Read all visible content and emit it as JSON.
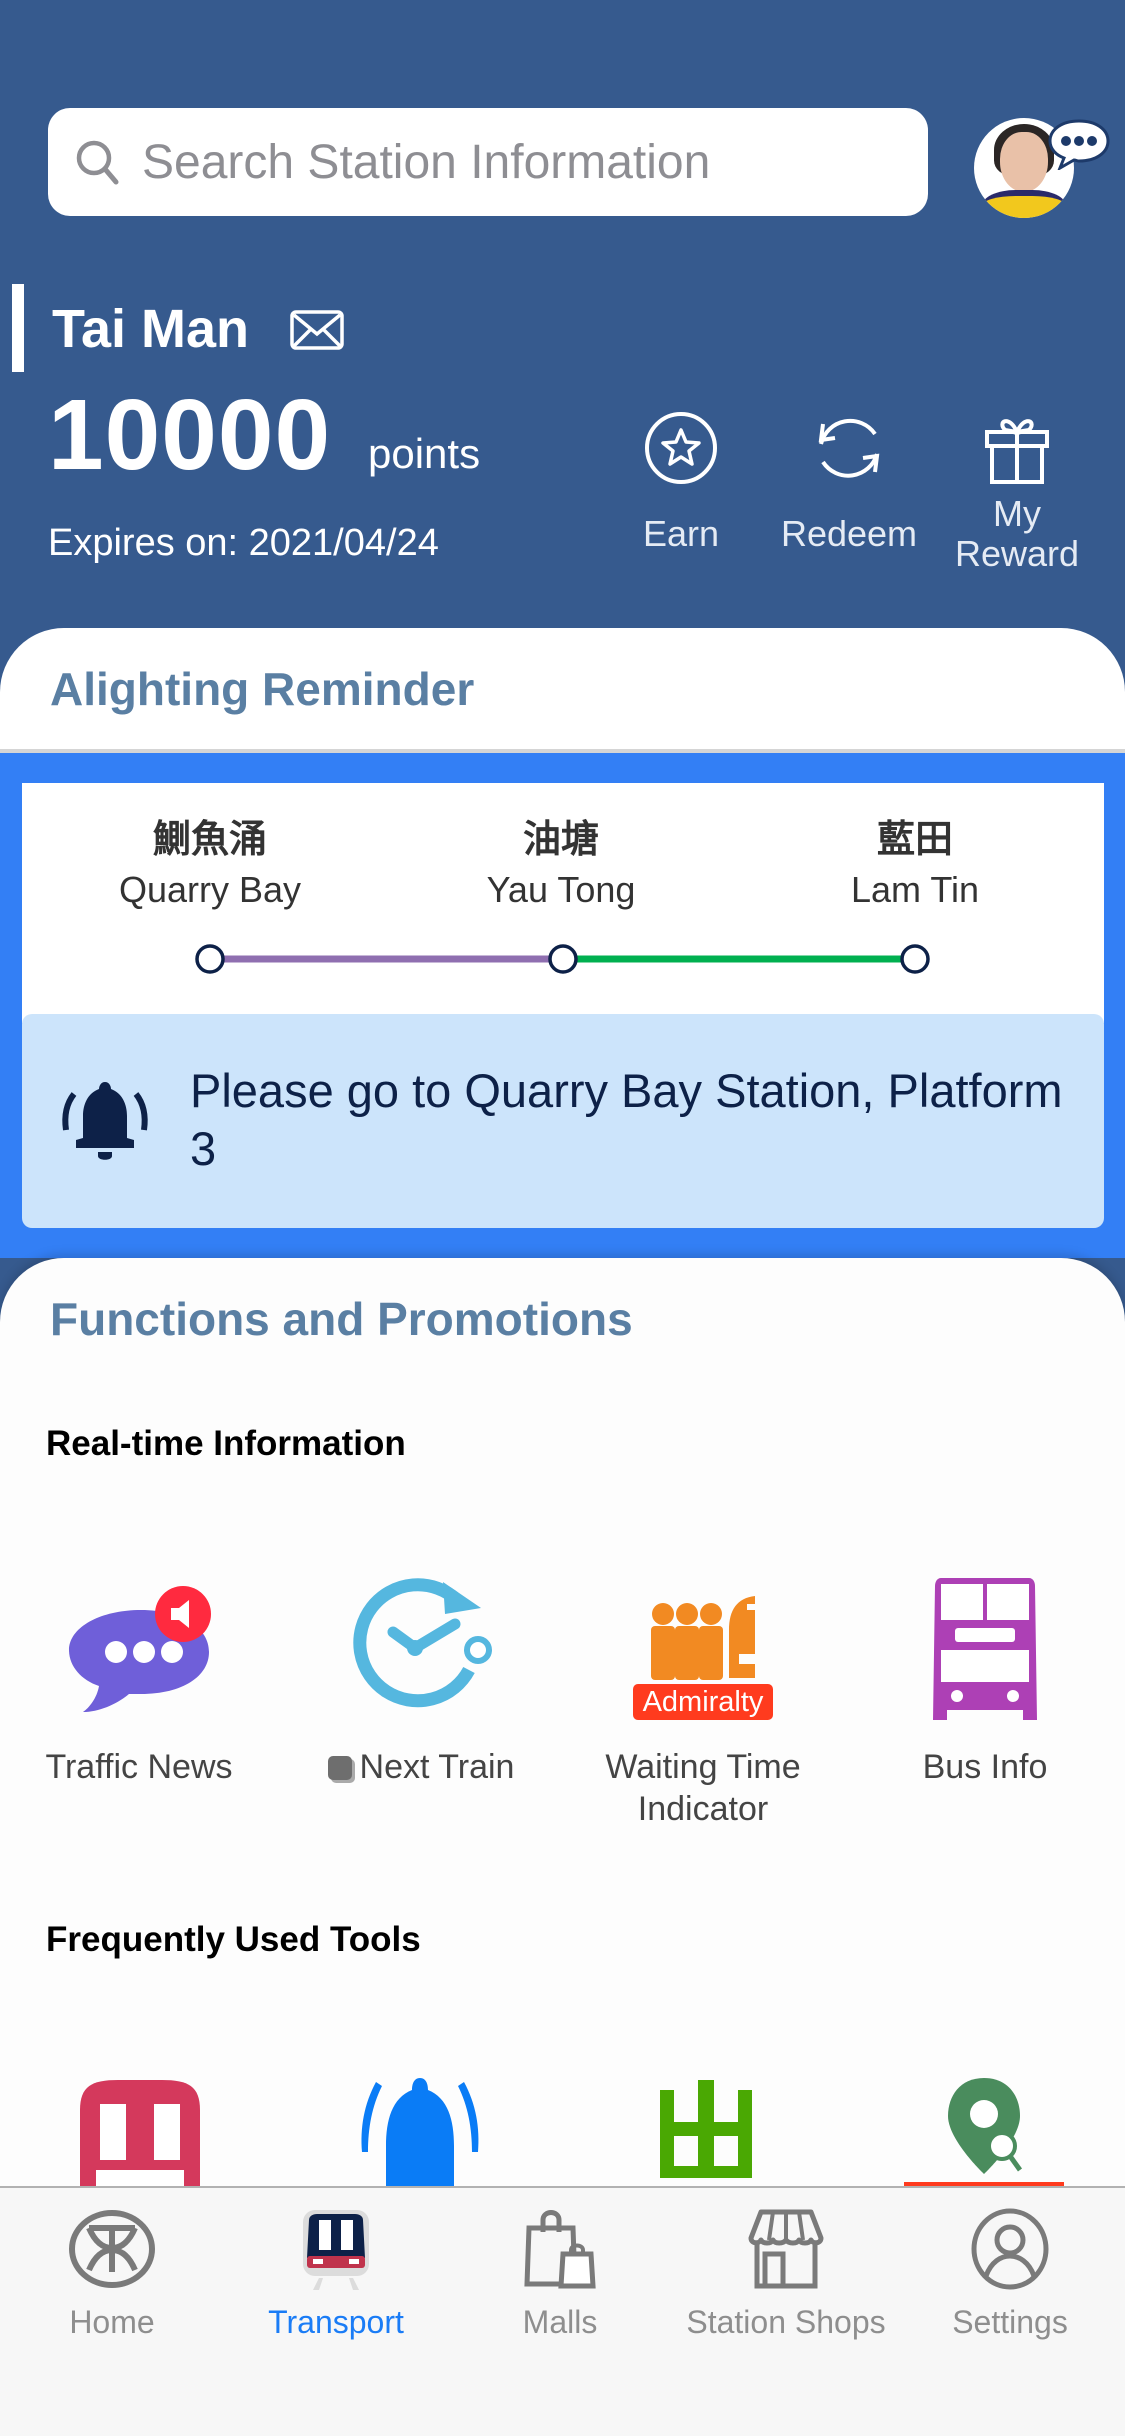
{
  "search": {
    "placeholder": "Search Station Information"
  },
  "user": {
    "name": "Tai Man",
    "points": "10000",
    "points_unit": "points",
    "expires": "Expires on: 2021/04/24"
  },
  "actions": [
    {
      "label": "Earn",
      "icon": "star-circle-icon"
    },
    {
      "label": "Redeem",
      "icon": "refresh-icon"
    },
    {
      "label": "My Reward",
      "icon": "gift-icon"
    }
  ],
  "alighting": {
    "title": "Alighting Reminder",
    "stations": [
      {
        "zh": "鰂魚涌",
        "en": "Quarry Bay"
      },
      {
        "zh": "油塘",
        "en": "Yau Tong"
      },
      {
        "zh": "藍田",
        "en": "Lam Tin"
      }
    ],
    "line_colors": [
      "#8f6fb0",
      "#00b050"
    ],
    "message": "Please go to Quarry Bay Station, Platform 3"
  },
  "functions": {
    "title": "Functions and Promotions",
    "realtime_title": "Real-time Information",
    "realtime": [
      {
        "label": "Traffic News",
        "icon": "chat-bubble-icon"
      },
      {
        "label": "Next Train",
        "icon": "clock-icon"
      },
      {
        "label": "Waiting Time Indicator",
        "icon": "queue-icon",
        "badge": "Admiralty"
      },
      {
        "label": "Bus Info",
        "icon": "bus-icon"
      }
    ],
    "tools_title": "Frequently Used Tools",
    "tools": [
      {
        "icon": "train-icon"
      },
      {
        "icon": "bell-icon"
      },
      {
        "icon": "exit-icon"
      },
      {
        "icon": "location-search-icon"
      }
    ]
  },
  "tabs": [
    {
      "label": "Home",
      "active": false
    },
    {
      "label": "Transport",
      "active": true
    },
    {
      "label": "Malls",
      "active": false
    },
    {
      "label": "Station Shops",
      "active": false
    },
    {
      "label": "Settings",
      "active": false
    }
  ]
}
